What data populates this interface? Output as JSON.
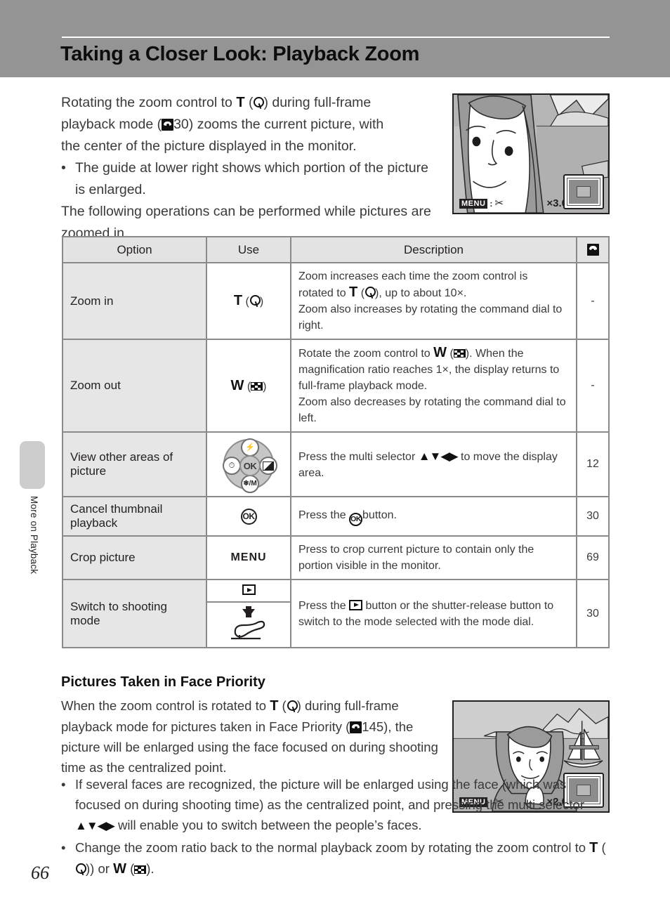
{
  "page": {
    "title": "Taking a Closer Look: Playback Zoom",
    "number": "66",
    "side_tab_label": "More on Playback"
  },
  "intro": {
    "line1_a": "Rotating the zoom control to ",
    "line1_t": "T",
    "line1_b": ") during full-frame",
    "line2_a": "playback mode (",
    "line2_ref": "30",
    "line2_b": ") zooms the current picture, with",
    "line3": "the center of the picture displayed in the monitor.",
    "bullet": "The guide at lower right shows which portion of the picture is enlarged.",
    "closing": "The following operations can be performed while pictures are zoomed in."
  },
  "lcd_top": {
    "menu_label": "MENU",
    "menu_separator": ":",
    "scissors_icon": "scissors-icon",
    "zoom_ratio": "×3.0",
    "guide_icon": "zoom-guide-box"
  },
  "lcd_bottom": {
    "menu_label": "MENU",
    "menu_separator": ":",
    "scissors_icon": "scissors-icon",
    "zoom_ratio": "×2.0",
    "guide_icon": "zoom-guide-box"
  },
  "table": {
    "headers": {
      "option": "Option",
      "use": "Use",
      "description": "Description",
      "reference": "reference-book-icon"
    },
    "rows": [
      {
        "option": "Zoom in",
        "use_label": "T",
        "use_icon": "magnifier-icon",
        "desc_line1_a": "Zoom increases each time the zoom control is",
        "desc_line2_a": "rotated to ",
        "desc_line2_t": "T",
        "desc_line2_b": "), up to about 10×.",
        "desc_line3": "Zoom also increases by rotating the command dial to right.",
        "ref": "-"
      },
      {
        "option": "Zoom out",
        "use_label": "W",
        "use_icon": "thumbnail-grid-icon",
        "desc_line1_a": "Rotate the zoom control to ",
        "desc_line1_w": "W",
        "desc_line1_b": "). When the magnification ratio reaches 1×, the display returns to full-frame playback mode.",
        "desc_line3": "Zoom also decreases by rotating the command dial to left.",
        "ref": "-"
      },
      {
        "option": "View other areas of picture",
        "use_icon": "multi-selector-dial",
        "desc_a": "Press the multi selector ",
        "desc_arrows": "▲▼◀▶",
        "desc_b": " to move the display area.",
        "ref": "12"
      },
      {
        "option": "Cancel thumbnail playback",
        "use_icon": "ok-button-icon",
        "use_label": "OK",
        "desc_a": "Press the ",
        "desc_b": "button.",
        "ref": "30"
      },
      {
        "option": "Crop picture",
        "use_label": "MENU",
        "use_icon": "menu-button-icon",
        "desc": "Press to crop current picture to contain only the portion visible in the monitor.",
        "ref": "69"
      },
      {
        "option": "Switch to shooting mode",
        "use_icon_top": "playback-button-icon",
        "use_icon_bottom": "shutter-release-icon",
        "desc_a": "Press the ",
        "desc_b": " button or the shutter-release button to switch to the mode selected with the mode dial.",
        "ref": "30"
      }
    ]
  },
  "face_priority": {
    "heading": "Pictures Taken in Face Priority",
    "para_a": "When the zoom control is rotated to ",
    "para_t": "T",
    "para_b": ") during full-frame playback mode for pictures taken in Face Priority (",
    "para_ref": "145",
    "para_c": "), the picture will be enlarged using the face focused on during shooting time as the centralized point.",
    "bullet1_a": "If several faces are recognized, the picture will be enlarged using the face (which was focused on during shooting time) as the centralized point, and pressing the multi selector ",
    "bullet1_arrows": "▲▼◀▶",
    "bullet1_b": " will enable you to switch between the people’s faces.",
    "bullet2_a": "Change the zoom ratio back to the normal playback zoom by rotating the zoom control to ",
    "bullet2_t": "T",
    "bullet2_mid": ") or ",
    "bullet2_w": "W",
    "bullet2_end": ")."
  },
  "colors": {
    "header_band": "#949494",
    "table_border": "#8a8a8a",
    "option_cell": "#e6e6e6",
    "header_cell": "#e3e3e3",
    "side_tab": "#cdcdcd"
  }
}
